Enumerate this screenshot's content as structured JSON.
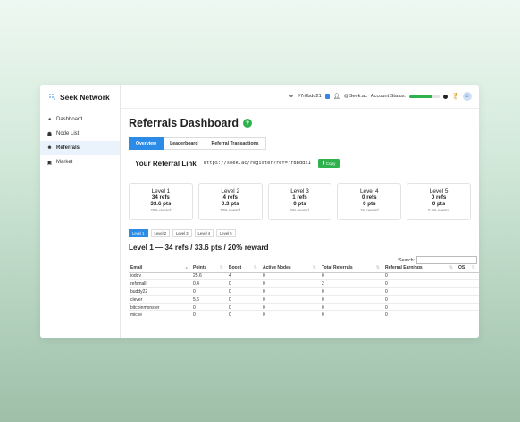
{
  "brand": {
    "name": "Seek Network"
  },
  "sidebar": {
    "items": [
      {
        "label": "Dashboard",
        "icon": "gauge-icon"
      },
      {
        "label": "Node List",
        "icon": "nodes-icon"
      },
      {
        "label": "Referrals",
        "icon": "add-user-icon"
      },
      {
        "label": "Market",
        "icon": "store-icon"
      }
    ]
  },
  "topbar": {
    "ref_code": "#7r8bdd21",
    "user": "@Seek.ac",
    "status_label": "Account Status:",
    "status_progress": 0.75,
    "status_color": "#2fb24d"
  },
  "page": {
    "title": "Referrals Dashboard",
    "help_glyph": "?"
  },
  "tabs": [
    "Overview",
    "Leaderboard",
    "Referral Transactions"
  ],
  "referral": {
    "label": "Your Referral Link",
    "url": "https://seek.ac/register?ref=7r8bdd21",
    "copy_label": "Copy"
  },
  "levels": [
    {
      "title": "Level 1",
      "refs": "34 refs",
      "pts": "33.6 pts",
      "reward": "20% reward"
    },
    {
      "title": "Level 2",
      "refs": "4 refs",
      "pts": "0.3 pts",
      "reward": "10% reward"
    },
    {
      "title": "Level 3",
      "refs": "1 refs",
      "pts": "0 pts",
      "reward": "5% reward"
    },
    {
      "title": "Level 4",
      "refs": "0 refs",
      "pts": "0 pts",
      "reward": "1% reward"
    },
    {
      "title": "Level 5",
      "refs": "0 refs",
      "pts": "0 pts",
      "reward": "0.5% reward"
    }
  ],
  "level_tabs": [
    "Level 1",
    "Level 2",
    "Level 3",
    "Level 4",
    "Level 5"
  ],
  "level_heading": "Level 1 — 34 refs / 33.6 pts / 20% reward",
  "search": {
    "label": "Search:",
    "placeholder": ""
  },
  "table": {
    "columns": [
      "Email",
      "Points",
      "Boost",
      "Active Nodes",
      "Total Referrals",
      "Referral Earnings",
      "OS"
    ],
    "rows": [
      [
        "joddy",
        "25.6",
        "4",
        "0",
        "0",
        "0",
        ""
      ],
      [
        "refsmall",
        "0.4",
        "0",
        "0",
        "2",
        "0",
        ""
      ],
      [
        "buddy22",
        "0",
        "0",
        "0",
        "0",
        "0",
        ""
      ],
      [
        "clever",
        "5.6",
        "0",
        "0",
        "0",
        "0",
        ""
      ],
      [
        "bitcoinmonster",
        "0",
        "0",
        "0",
        "0",
        "0",
        ""
      ],
      [
        "micke",
        "0",
        "0",
        "0",
        "0",
        "0",
        ""
      ]
    ]
  }
}
